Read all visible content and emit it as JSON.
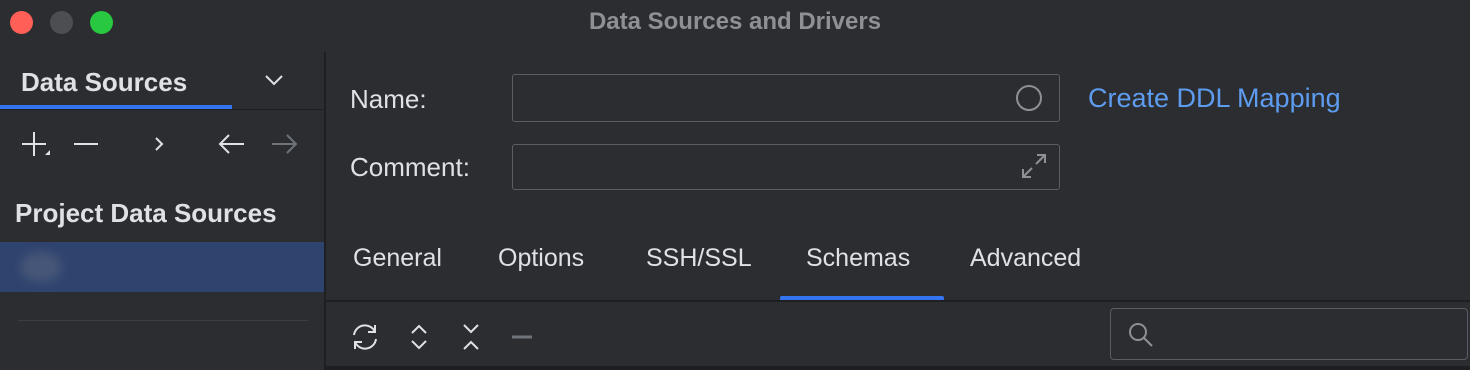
{
  "window": {
    "title": "Data Sources and Drivers"
  },
  "sidebar": {
    "tab_label": "Data Sources",
    "section_title": "Project Data Sources",
    "toolbar": [
      "add-icon",
      "remove-icon",
      "expand-arrow-icon",
      "back-arrow-icon",
      "forward-arrow-icon"
    ]
  },
  "form": {
    "name_label": "Name:",
    "name_value": "",
    "comment_label": "Comment:",
    "comment_value": "",
    "ddl_link": "Create DDL Mapping"
  },
  "tabs": [
    {
      "label": "General"
    },
    {
      "label": "Options"
    },
    {
      "label": "SSH/SSL"
    },
    {
      "label": "Schemas",
      "selected": true
    },
    {
      "label": "Advanced"
    }
  ],
  "content_toolbar": [
    "refresh-icon",
    "expand-all-icon",
    "collapse-all-icon",
    "minus-icon"
  ],
  "search": {
    "placeholder": ""
  },
  "colors": {
    "accent": "#3574f0",
    "link": "#5e9cf0",
    "background": "#2b2d30",
    "selected_row": "#2e436e"
  }
}
